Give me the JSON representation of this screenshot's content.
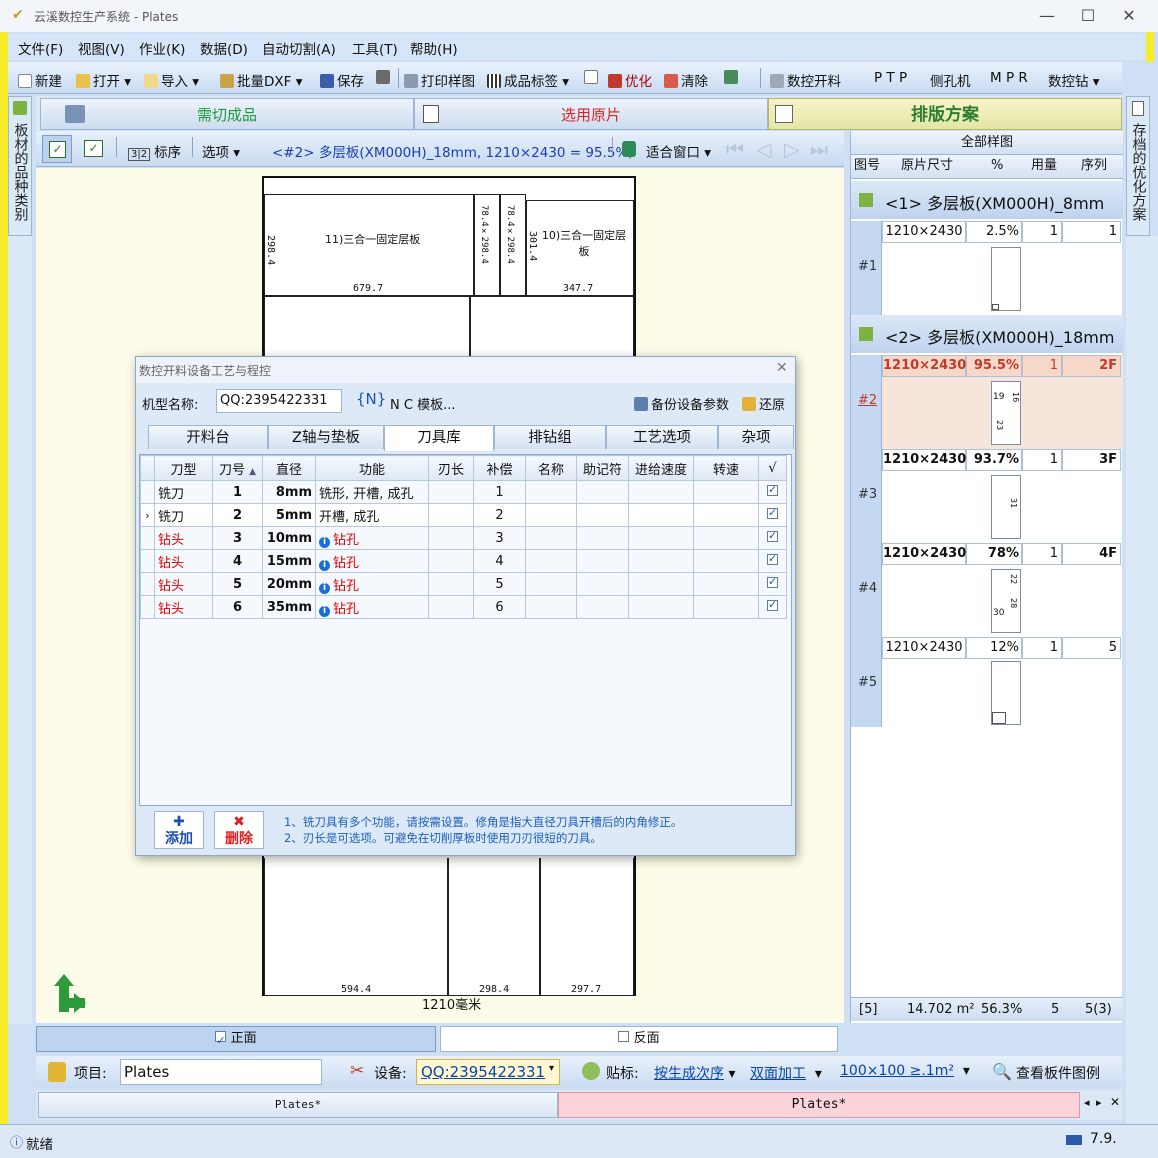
{
  "window": {
    "title": "云溪数控生产系统 - Plates"
  },
  "menu": [
    "文件(F)",
    "视图(V)",
    "作业(K)",
    "数据(D)",
    "自动切割(A)",
    "工具(T)",
    "帮助(H)"
  ],
  "toolbar": {
    "new": "新建",
    "open": "打开",
    "import": "导入",
    "batch_dxf": "批量DXF",
    "save": "保存",
    "print": "打印样图",
    "label": "成品标签",
    "optimize": "优化",
    "clear": "清除",
    "nc_cut": "数控开料",
    "ptp": "P T P",
    "side_drill": "侧孔机",
    "mpr": "M P R",
    "nc_drill": "数控钻"
  },
  "left_sidebar": {
    "label": "板材的品种类别"
  },
  "right_sidebar": {
    "label": "存档的优化方案"
  },
  "main_tabs": [
    {
      "label": "需切成品"
    },
    {
      "label": "选用原片"
    },
    {
      "label": "排版方案"
    }
  ],
  "canvas_toolbar": {
    "mark_order": "标序",
    "options": "选项",
    "plate_info": "<#2> 多层板(XM000H)_18mm,  1210×2430  =  95.5%,",
    "fit_window": "适合窗口"
  },
  "sheet": {
    "parts": [
      {
        "label": "11)三合一固定层板"
      },
      {
        "label": "10)三合一固定层板"
      }
    ],
    "dims": {
      "d1": "679.7",
      "d2": "347.7",
      "d3": "298.4",
      "d4": "301.4",
      "d5": "594.4",
      "d6": "298.4",
      "d7": "297.7",
      "d8": "78.4×298.4",
      "d9": "78.4×298.4"
    },
    "width_label": "1210毫米"
  },
  "face_toggle": {
    "front": "正面",
    "back": "反面"
  },
  "dialog": {
    "title": "数控开料设备工艺与程控",
    "machine_label": "机型名称:",
    "machine_value": "QQ:2395422331",
    "nc_template": "N C 模板...",
    "backup": "备份设备参数",
    "restore": "还原",
    "tabs": [
      "开料台",
      "Z轴与垫板",
      "刀具库",
      "排钻组",
      "工艺选项",
      "杂项"
    ],
    "columns": [
      "刀型",
      "刀号",
      "直径",
      "功能",
      "刃长",
      "补偿",
      "名称",
      "助记符",
      "进给速度",
      "转速",
      "√"
    ],
    "rows": [
      {
        "type": "铣刀",
        "no": "1",
        "dia": "8mm",
        "func": "铣形, 开槽, 成孔",
        "comp": "1"
      },
      {
        "type": "铣刀",
        "no": "2",
        "dia": "5mm",
        "func": "开槽, 成孔",
        "comp": "2"
      },
      {
        "type": "钻头",
        "no": "3",
        "dia": "10mm",
        "func": "钻孔",
        "comp": "3"
      },
      {
        "type": "钻头",
        "no": "4",
        "dia": "15mm",
        "func": "钻孔",
        "comp": "4"
      },
      {
        "type": "钻头",
        "no": "5",
        "dia": "20mm",
        "func": "钻孔",
        "comp": "5"
      },
      {
        "type": "钻头",
        "no": "6",
        "dia": "35mm",
        "func": "钻孔",
        "comp": "6"
      }
    ],
    "add": "添加",
    "delete": "删除",
    "note1": "1、铣刀具有多个功能，请按需设置。修角是指大直径刀具开槽后的内角修正。",
    "note2": "2、刃长是可选项。可避免在切削厚板时使用刀刃很短的刀具。"
  },
  "right_panel": {
    "title": "全部样图",
    "columns": [
      "图号",
      "原片尺寸",
      "%",
      "用量",
      "序列"
    ],
    "group1": "<1> 多层板(XM000H)_8mm",
    "group2": "<2> 多层板(XM000H)_18mm",
    "rows": [
      {
        "id": "#1",
        "size": "1210×2430",
        "pct": "2.5%",
        "qty": "1",
        "seq": "1"
      },
      {
        "id": "#2",
        "size": "1210×2430",
        "pct": "95.5%",
        "qty": "1",
        "seq": "2F"
      },
      {
        "id": "#3",
        "size": "1210×2430",
        "pct": "93.7%",
        "qty": "1",
        "seq": "3F"
      },
      {
        "id": "#4",
        "size": "1210×2430",
        "pct": "78%",
        "qty": "1",
        "seq": "4F"
      },
      {
        "id": "#5",
        "size": "1210×2430",
        "pct": "12%",
        "qty": "1",
        "seq": "5"
      }
    ],
    "thumb_labels": {
      "t2a": "19",
      "t2b": "16",
      "t2c": "23",
      "t3a": "31",
      "t4a": "22",
      "t4b": "28",
      "t4c": "30"
    },
    "summary": {
      "count": "[5]",
      "area": "14.702 m²",
      "pct": "56.3%",
      "qty": "5",
      "seq": "5(3)"
    }
  },
  "bottom": {
    "project_label": "项目:",
    "project_value": "Plates",
    "device_label": "设备:",
    "device_value": "QQ:2395422331",
    "label_label": "贴标:",
    "sort": "按生成次序",
    "process": "双面加工",
    "size_filter": "100×100 ≥.1m²",
    "view_legend": "查看板件图例"
  },
  "file_tabs": [
    "Plates*",
    "Plates*"
  ],
  "status": {
    "text": "就绪",
    "version": "7.9."
  }
}
